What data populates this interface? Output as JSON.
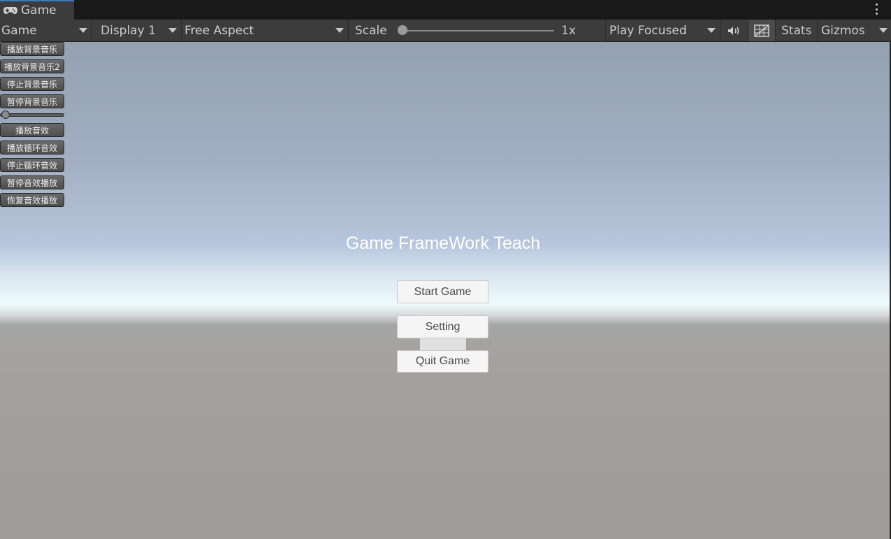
{
  "tab": {
    "label": "Game",
    "icon": "gamepad-icon"
  },
  "toolbar": {
    "view_mode": "Game",
    "display": "Display 1",
    "aspect": "Free Aspect",
    "scale_label": "Scale",
    "scale_value": "1x",
    "play_mode": "Play Focused",
    "stats": "Stats",
    "gizmos": "Gizmos",
    "mute_icon": "speaker-icon",
    "grid_icon": "grid-icon"
  },
  "debug_panel": {
    "buttons": [
      "播放背景音乐",
      "播放背景音乐2",
      "停止背景音乐",
      "暂停背景音乐",
      "播放音效",
      "播放循环音效",
      "停止循环音效",
      "暂停音效播放",
      "恢复音效播放"
    ],
    "volume_slider_value": 0
  },
  "game_ui": {
    "title": "Game FrameWork Teach",
    "start": "Start Game",
    "setting": "Setting",
    "quit": "Quit Game"
  }
}
